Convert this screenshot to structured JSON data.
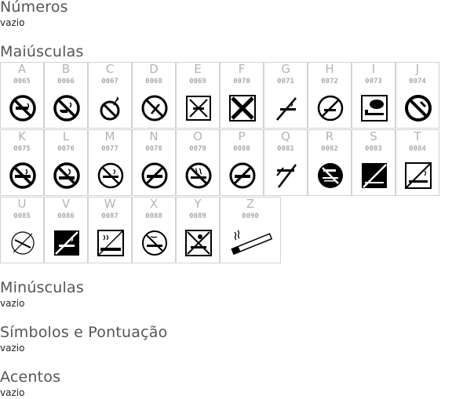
{
  "sections": {
    "numeros": {
      "title": "Números",
      "empty": "vazio"
    },
    "maiusculas": {
      "title": "Maiúsculas"
    },
    "minusculas": {
      "title": "Minúsculas",
      "empty": "vazio"
    },
    "simbolos": {
      "title": "Símbolos e Pontuação",
      "empty": "vazio"
    },
    "acentos": {
      "title": "Acentos",
      "empty": "vazio"
    }
  },
  "glyphs": [
    {
      "letter": "A",
      "code": "0065",
      "icon": "no-smoking-cigarette-circle-icon"
    },
    {
      "letter": "B",
      "code": "0066",
      "icon": "no-smoking-pipe-circle-icon"
    },
    {
      "letter": "C",
      "code": "0067",
      "icon": "no-smoking-match-circle-icon"
    },
    {
      "letter": "D",
      "code": "0068",
      "icon": "no-smoking-slash-circle-icon"
    },
    {
      "letter": "E",
      "code": "0069",
      "icon": "no-smoking-box-cross-icon"
    },
    {
      "letter": "F",
      "code": "0070",
      "icon": "no-smoking-black-cross-box-icon"
    },
    {
      "letter": "G",
      "code": "0071",
      "icon": "no-smoking-slash-icon"
    },
    {
      "letter": "H",
      "code": "0072",
      "icon": "no-smoking-thin-circle-icon"
    },
    {
      "letter": "I",
      "code": "0073",
      "icon": "smoking-lounge-box-icon"
    },
    {
      "letter": "J",
      "code": "0074",
      "icon": "no-smoking-thick-circle-icon"
    },
    {
      "letter": "K",
      "code": "0075",
      "icon": "no-smoking-cigarette-circle-icon"
    },
    {
      "letter": "L",
      "code": "0076",
      "icon": "no-smoking-cigarette-circle-icon"
    },
    {
      "letter": "M",
      "code": "0077",
      "icon": "no-smoking-cigarette-circle-icon"
    },
    {
      "letter": "N",
      "code": "0078",
      "icon": "no-smoking-cigarette-circle-icon"
    },
    {
      "letter": "O",
      "code": "0079",
      "icon": "no-smoking-cigarette-circle-icon"
    },
    {
      "letter": "P",
      "code": "0080",
      "icon": "no-smoking-cigarette-circle-icon"
    },
    {
      "letter": "Q",
      "code": "0081",
      "icon": "no-smoking-slash-icon"
    },
    {
      "letter": "R",
      "code": "0082",
      "icon": "no-smoking-black-disc-icon"
    },
    {
      "letter": "S",
      "code": "0083",
      "icon": "no-smoking-black-square-icon"
    },
    {
      "letter": "T",
      "code": "0084",
      "icon": "no-smoking-white-square-icon"
    },
    {
      "letter": "U",
      "code": "0085",
      "icon": "no-smoking-sketch-circle-icon"
    },
    {
      "letter": "V",
      "code": "0086",
      "icon": "no-smoking-black-square-icon"
    },
    {
      "letter": "W",
      "code": "0087",
      "icon": "no-smoking-white-square-icon"
    },
    {
      "letter": "X",
      "code": "0088",
      "icon": "no-smoking-cigarette-circle-icon"
    },
    {
      "letter": "Y",
      "code": "0089",
      "icon": "no-smoking-box-cross-icon"
    },
    {
      "letter": "Z",
      "code": "0090",
      "icon": "cigarette-icon"
    }
  ]
}
